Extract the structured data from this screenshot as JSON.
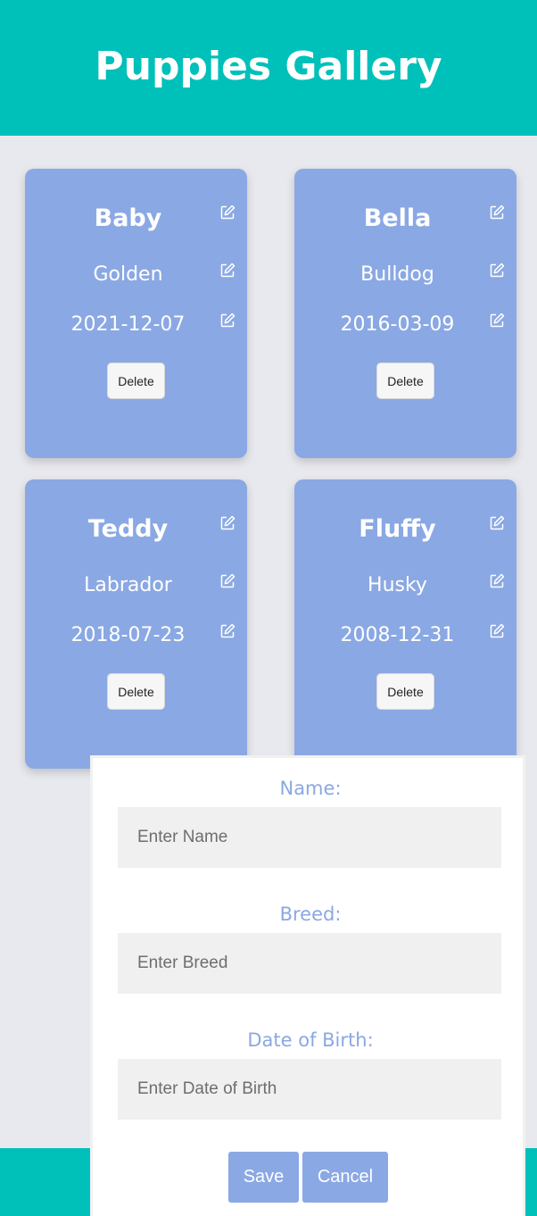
{
  "header": {
    "title": "Puppies Gallery"
  },
  "cards": [
    {
      "name": "Baby",
      "breed": "Golden",
      "dob": "2021-12-07",
      "delete_label": "Delete"
    },
    {
      "name": "Bella",
      "breed": "Bulldog",
      "dob": "2016-03-09",
      "delete_label": "Delete"
    },
    {
      "name": "Teddy",
      "breed": "Labrador",
      "dob": "2018-07-23",
      "delete_label": "Delete"
    },
    {
      "name": "Fluffy",
      "breed": "Husky",
      "dob": "2008-12-31",
      "delete_label": "Delete"
    }
  ],
  "form": {
    "name_label": "Name:",
    "name_placeholder": "Enter Name",
    "breed_label": "Breed:",
    "breed_placeholder": "Enter Breed",
    "dob_label": "Date of Birth:",
    "dob_placeholder": "Enter Date of Birth",
    "save_label": "Save",
    "cancel_label": "Cancel"
  },
  "icons": {
    "edit": "edit-icon"
  },
  "colors": {
    "header_bg": "#00c0ba",
    "card_bg": "#8aa8e3",
    "page_bg": "#e8e9ee",
    "form_accent": "#8aa8e3"
  }
}
